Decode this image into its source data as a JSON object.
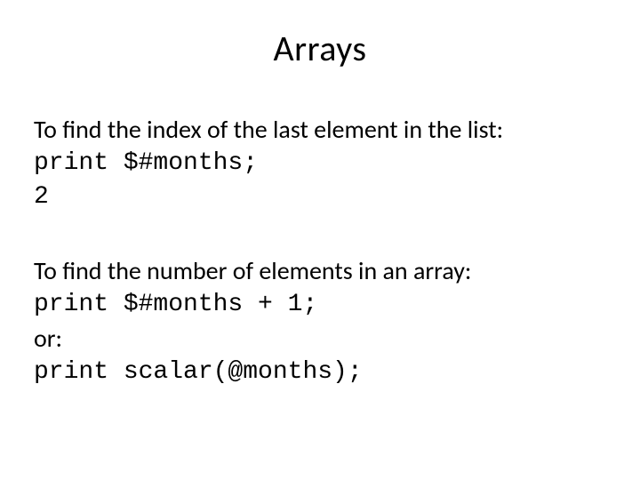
{
  "title": "Arrays",
  "block1": {
    "intro": "To find the index of the last element in the list:",
    "code": "print $#months;",
    "result": "2"
  },
  "block2": {
    "intro": "To find the number of elements in an array:",
    "code1": "print $#months + 1;",
    "or": "or:",
    "code2": "print scalar(@months);"
  }
}
